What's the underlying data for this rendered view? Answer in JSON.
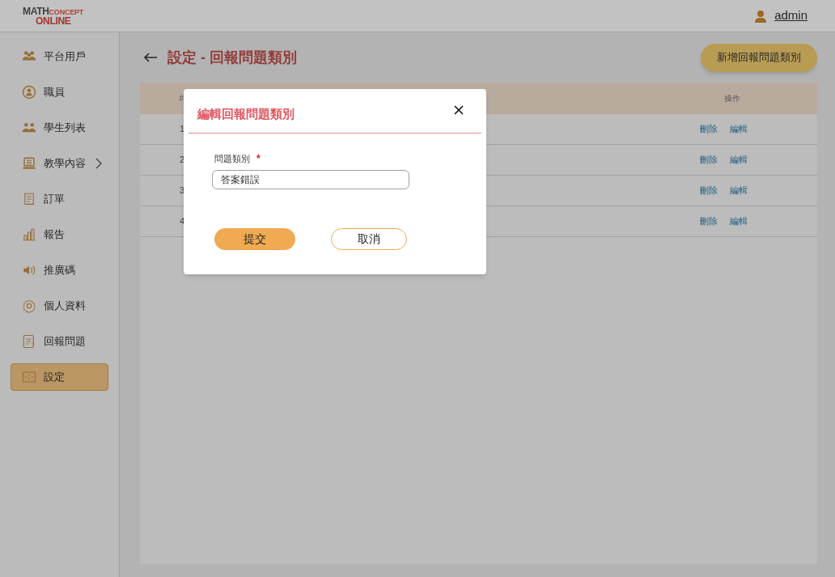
{
  "logo": {
    "line1a": "MATH",
    "line1b": "CONCEPT",
    "line2": "ONLINE"
  },
  "user": {
    "name": "admin"
  },
  "sidebar": {
    "items": [
      {
        "label": "平台用戶",
        "selected": false,
        "has_submenu": false
      },
      {
        "label": "職員",
        "selected": false,
        "has_submenu": false
      },
      {
        "label": "學生列表",
        "selected": false,
        "has_submenu": false
      },
      {
        "label": "教學內容",
        "selected": false,
        "has_submenu": true
      },
      {
        "label": "訂單",
        "selected": false,
        "has_submenu": false
      },
      {
        "label": "報告",
        "selected": false,
        "has_submenu": false
      },
      {
        "label": "推廣碼",
        "selected": false,
        "has_submenu": false
      },
      {
        "label": "個人資料",
        "selected": false,
        "has_submenu": false
      },
      {
        "label": "回報問題",
        "selected": false,
        "has_submenu": false
      },
      {
        "label": "設定",
        "selected": true,
        "has_submenu": false
      }
    ]
  },
  "page": {
    "title": "設定 - 回報問題類別",
    "add_button": "新增回報問題類別"
  },
  "table": {
    "columns": [
      "#",
      "操作"
    ],
    "rows": [
      {
        "index": "1",
        "actions": [
          "刪除",
          "編輯"
        ]
      },
      {
        "index": "2",
        "actions": [
          "刪除",
          "編輯"
        ]
      },
      {
        "index": "3",
        "actions": [
          "刪除",
          "編輯"
        ]
      },
      {
        "index": "4",
        "actions": [
          "刪除",
          "編輯"
        ]
      }
    ]
  },
  "modal": {
    "title": "編輯回報問題類別",
    "field_label": "問題類別",
    "required_mark": "*",
    "field_value": "答案錯誤",
    "submit": "提交",
    "cancel": "取消"
  }
}
